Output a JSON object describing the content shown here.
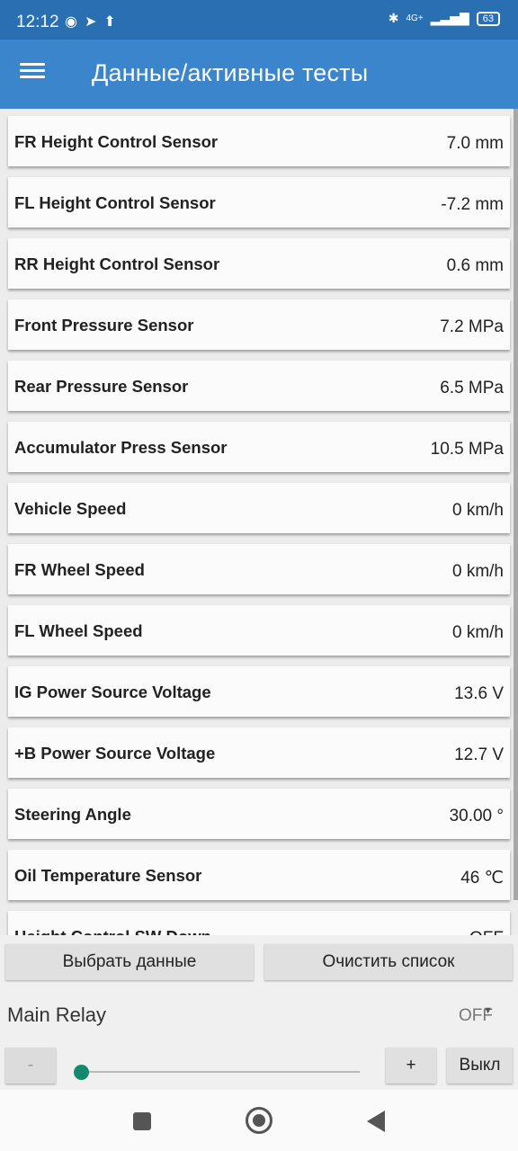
{
  "status_bar": {
    "time": "12:12",
    "network": "4G+",
    "battery": "63"
  },
  "app_bar": {
    "title": "Данные/активные тесты"
  },
  "rows": [
    {
      "name": "FR Height Control Sensor",
      "value": "7.0 mm"
    },
    {
      "name": "FL Height Control Sensor",
      "value": "-7.2 mm"
    },
    {
      "name": "RR Height Control Sensor",
      "value": "0.6 mm"
    },
    {
      "name": "Front Pressure Sensor",
      "value": "7.2 MPa"
    },
    {
      "name": "Rear Pressure Sensor",
      "value": "6.5 MPa"
    },
    {
      "name": "Accumulator Press Sensor",
      "value": "10.5 MPa"
    },
    {
      "name": "Vehicle Speed",
      "value": "0 km/h"
    },
    {
      "name": "FR Wheel Speed",
      "value": "0 km/h"
    },
    {
      "name": "FL Wheel Speed",
      "value": "0 km/h"
    },
    {
      "name": "IG Power Source Voltage",
      "value": "13.6 V"
    },
    {
      "name": "+B Power Source Voltage",
      "value": "12.7 V"
    },
    {
      "name": "Steering Angle",
      "value": "30.00 °"
    },
    {
      "name": "Oil Temperature Sensor",
      "value": "46 ℃"
    },
    {
      "name": "Height Control SW Down",
      "value": "OFF"
    }
  ],
  "buttons": {
    "select_data": "Выбрать данные",
    "clear_list": "Очистить список"
  },
  "active_test": {
    "label": "Main Relay",
    "value": "OFF",
    "minus": "-",
    "plus": "+",
    "off": "Выкл",
    "slider_level": 0
  }
}
